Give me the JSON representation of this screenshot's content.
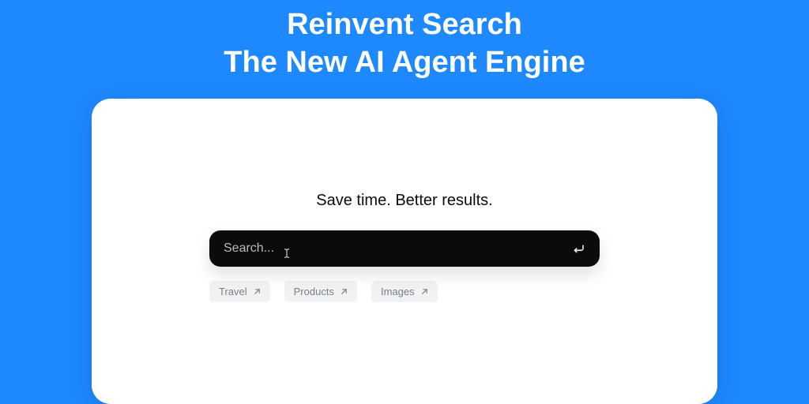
{
  "hero": {
    "line1": "Reinvent Search",
    "line2": "The New AI Agent Engine"
  },
  "tagline": "Save time. Better results.",
  "search": {
    "placeholder": "Search...",
    "value": ""
  },
  "chips": [
    {
      "label": "Travel"
    },
    {
      "label": "Products"
    },
    {
      "label": "Images"
    }
  ],
  "colors": {
    "background": "#1e88ff",
    "card": "#ffffff",
    "searchbar": "#0b0b0b",
    "chip_bg": "#f1f2f3",
    "chip_text": "#7a7f85"
  }
}
